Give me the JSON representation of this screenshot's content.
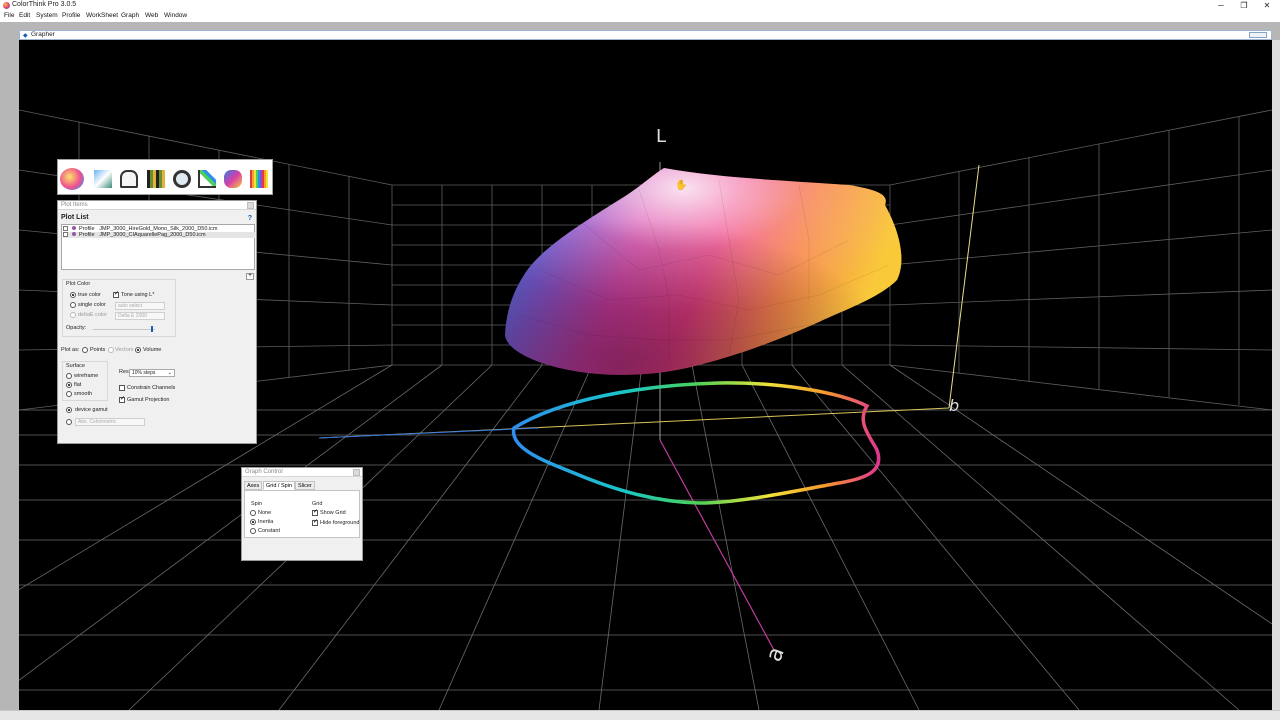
{
  "window": {
    "title": "ColorThink Pro 3.0.5",
    "minimize_glyph": "─",
    "restore_glyph": "❐",
    "close_glyph": "✕"
  },
  "menu": [
    "File",
    "Edit",
    "System",
    "Profile",
    "WorkSheet",
    "Graph",
    "Web",
    "Window"
  ],
  "grapher": {
    "title": "Grapher",
    "icon": "grapher-icon"
  },
  "axes": {
    "l_label": "L",
    "b_label": "b",
    "a_label": "a"
  },
  "toolbar_icons": [
    "color-worksheet-icon",
    "profile-inspector-icon",
    "color-list-icon",
    "film-icon",
    "magnifier-icon",
    "chart-icon",
    "3d-gamut-icon",
    "rainbow-icon"
  ],
  "plot_items": {
    "title": "Plot Items",
    "header": "Plot List",
    "help": "?",
    "rows": [
      {
        "type": "Profile",
        "name": "JMP_3000_HireGold_Mono_Silk_2000_D50.icm"
      },
      {
        "type": "Profile",
        "name": "JMP_3000_CIAquarellePag_2000_D50.icm"
      }
    ],
    "add_button": "+",
    "plot_color": {
      "label": "Plot Color",
      "true_color": "true color",
      "single_color": "single color",
      "deltae_color": "deltaE color",
      "tone_using": "Tone using L*",
      "auto_select": "auto select",
      "delta_e_method": "Delta E 2000",
      "opacity": "Opacity:",
      "opacity_value": 0.95
    },
    "plot_as": {
      "label": "Plot as:",
      "points": "Points",
      "vectors": "Vectors",
      "volume": "Volume"
    },
    "surface": {
      "label": "Surface",
      "wireframe": "wireframe",
      "flat": "flat",
      "smooth": "smooth",
      "res_label": "Res",
      "res_value": "10% steps",
      "constrain": "Constrain Channels",
      "gamut_projection": "Gamut Projection"
    },
    "device_gamut": "device gamut",
    "abs_colorimetric": "Abs. Colorimetric"
  },
  "graph_control": {
    "title": "Graph Control",
    "tabs": [
      "Axes",
      "Grid / Spin",
      "Slicer"
    ],
    "active_tab": 1,
    "spin": {
      "label": "Spin",
      "none": "None",
      "inertia": "Inertia",
      "constant": "Constant"
    },
    "grid": {
      "label": "Grid",
      "show_grid": "Show Grid",
      "hide_foreground": "Hide foreground"
    }
  },
  "colors": {
    "canvas_bg": "#000000",
    "grid_line": "#6e6e6e",
    "workspace_bg": "#b6b6b6",
    "accent": "#1a5fb4"
  }
}
